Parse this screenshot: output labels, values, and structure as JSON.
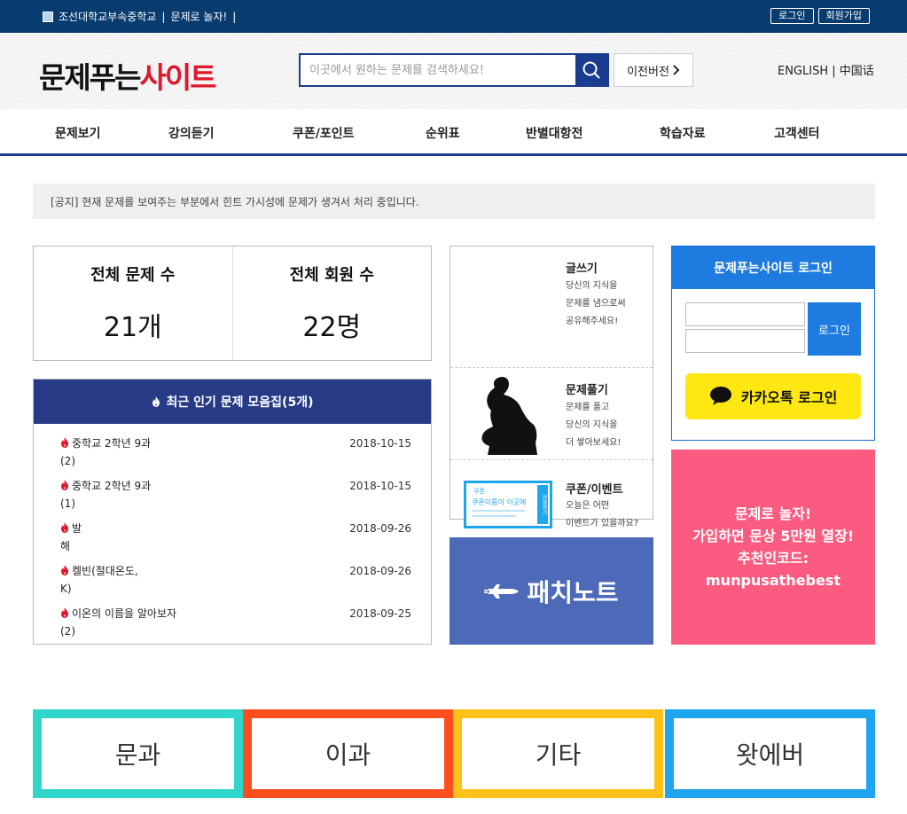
{
  "topbar": {
    "school": "조선대학교부속중학교",
    "tagline": "문제로 놀자!",
    "separator": "|",
    "login_label": "로그인",
    "signup_label": "회원가입"
  },
  "header": {
    "logo_part1": "문제푸는",
    "logo_part2": "사이트",
    "search_placeholder": "이곳에서 원하는 문제를 검색하세요!",
    "old_version_label": "이전버전",
    "lang_english": "ENGLISH",
    "lang_separator": "|",
    "lang_chinese": "中国话"
  },
  "nav": {
    "items": [
      "문제보기",
      "강의듣기",
      "쿠폰/포인트",
      "순위표",
      "반별대항전",
      "학습자료",
      "고객센터"
    ]
  },
  "notice": {
    "text": "[공지] 현재 문제를 보여주는 부분에서 힌트 가시성에 문제가 생겨서 처리 중입니다."
  },
  "stats": {
    "problems_label": "전체 문제 수",
    "problems_value": "21개",
    "members_label": "전체 회원 수",
    "members_value": "22명"
  },
  "popular": {
    "title": "최근 인기 문제 모음집(5개)",
    "items": [
      {
        "line1": "중학교 2학년 9과",
        "line2": "(2)",
        "date": "2018-10-15"
      },
      {
        "line1": "중학교 2학년 9과",
        "line2": "(1)",
        "date": "2018-10-15"
      },
      {
        "line1": "발",
        "line2": "해",
        "date": "2018-09-26"
      },
      {
        "line1": "켈빈(절대온도,",
        "line2": "K)",
        "date": "2018-09-26"
      },
      {
        "line1": "이온의 이름을 알아보자",
        "line2": "(2)",
        "date": "2018-09-25"
      }
    ]
  },
  "cards": {
    "write": {
      "title": "글쓰기",
      "lines": [
        "당신의 지식을",
        "문제를 냄으로써",
        "공유해주세요!"
      ]
    },
    "solve": {
      "title": "문제풀기",
      "lines": [
        "문제를 풀고",
        "당신의 지식을",
        "더 쌓아보세요!"
      ]
    },
    "coupon": {
      "title": "쿠폰/이벤트",
      "lines": [
        "오늘은 어떤",
        "이벤트가 있을까요?"
      ]
    },
    "coupon_image": {
      "tag": "쿠폰",
      "name": "쿠폰이름이 이곳에",
      "side": "사용하기"
    }
  },
  "patch": {
    "label": "패치노트"
  },
  "login": {
    "title": "문제푸는사이트 로그인",
    "button_label": "로그인",
    "kakao_label": "카카오톡 로그인"
  },
  "promo": {
    "lines": [
      "문제로 놀자!",
      "가입하면 문상 5만원 열장!",
      "추천인코드:",
      "munpusathebest"
    ]
  },
  "categories": [
    {
      "label": "문과",
      "color": "#2fd6c9"
    },
    {
      "label": "이과",
      "color": "#fc4f1d"
    },
    {
      "label": "기타",
      "color": "#fdc11b"
    },
    {
      "label": "왓에버",
      "color": "#1fa5ee"
    }
  ],
  "colors": {
    "topbar": "#083b6e",
    "primary": "#1a3d8f",
    "popular_header": "#263a86",
    "login_blue": "#1e7be0",
    "patch_blue": "#4c6ab8",
    "promo_pink": "#fb5b80",
    "kakao_yellow": "#ffe812",
    "logo_red": "#e0162b"
  }
}
